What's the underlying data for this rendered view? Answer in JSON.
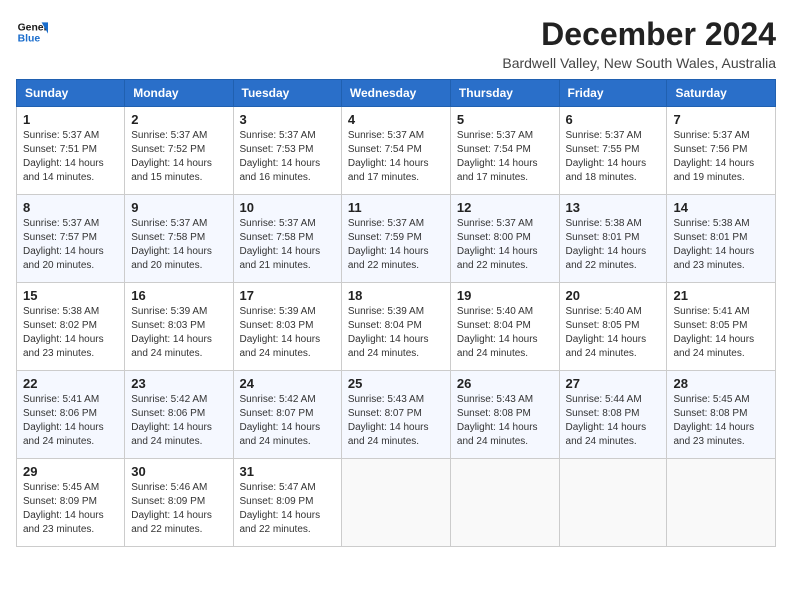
{
  "logo": {
    "text_general": "General",
    "text_blue": "Blue"
  },
  "title": "December 2024",
  "location": "Bardwell Valley, New South Wales, Australia",
  "days_of_week": [
    "Sunday",
    "Monday",
    "Tuesday",
    "Wednesday",
    "Thursday",
    "Friday",
    "Saturday"
  ],
  "weeks": [
    [
      {
        "day": 1,
        "sunrise": "5:37 AM",
        "sunset": "7:51 PM",
        "daylight": "14 hours and 14 minutes."
      },
      {
        "day": 2,
        "sunrise": "5:37 AM",
        "sunset": "7:52 PM",
        "daylight": "14 hours and 15 minutes."
      },
      {
        "day": 3,
        "sunrise": "5:37 AM",
        "sunset": "7:53 PM",
        "daylight": "14 hours and 16 minutes."
      },
      {
        "day": 4,
        "sunrise": "5:37 AM",
        "sunset": "7:54 PM",
        "daylight": "14 hours and 17 minutes."
      },
      {
        "day": 5,
        "sunrise": "5:37 AM",
        "sunset": "7:54 PM",
        "daylight": "14 hours and 17 minutes."
      },
      {
        "day": 6,
        "sunrise": "5:37 AM",
        "sunset": "7:55 PM",
        "daylight": "14 hours and 18 minutes."
      },
      {
        "day": 7,
        "sunrise": "5:37 AM",
        "sunset": "7:56 PM",
        "daylight": "14 hours and 19 minutes."
      }
    ],
    [
      {
        "day": 8,
        "sunrise": "5:37 AM",
        "sunset": "7:57 PM",
        "daylight": "14 hours and 20 minutes."
      },
      {
        "day": 9,
        "sunrise": "5:37 AM",
        "sunset": "7:58 PM",
        "daylight": "14 hours and 20 minutes."
      },
      {
        "day": 10,
        "sunrise": "5:37 AM",
        "sunset": "7:58 PM",
        "daylight": "14 hours and 21 minutes."
      },
      {
        "day": 11,
        "sunrise": "5:37 AM",
        "sunset": "7:59 PM",
        "daylight": "14 hours and 22 minutes."
      },
      {
        "day": 12,
        "sunrise": "5:37 AM",
        "sunset": "8:00 PM",
        "daylight": "14 hours and 22 minutes."
      },
      {
        "day": 13,
        "sunrise": "5:38 AM",
        "sunset": "8:01 PM",
        "daylight": "14 hours and 22 minutes."
      },
      {
        "day": 14,
        "sunrise": "5:38 AM",
        "sunset": "8:01 PM",
        "daylight": "14 hours and 23 minutes."
      }
    ],
    [
      {
        "day": 15,
        "sunrise": "5:38 AM",
        "sunset": "8:02 PM",
        "daylight": "14 hours and 23 minutes."
      },
      {
        "day": 16,
        "sunrise": "5:39 AM",
        "sunset": "8:03 PM",
        "daylight": "14 hours and 24 minutes."
      },
      {
        "day": 17,
        "sunrise": "5:39 AM",
        "sunset": "8:03 PM",
        "daylight": "14 hours and 24 minutes."
      },
      {
        "day": 18,
        "sunrise": "5:39 AM",
        "sunset": "8:04 PM",
        "daylight": "14 hours and 24 minutes."
      },
      {
        "day": 19,
        "sunrise": "5:40 AM",
        "sunset": "8:04 PM",
        "daylight": "14 hours and 24 minutes."
      },
      {
        "day": 20,
        "sunrise": "5:40 AM",
        "sunset": "8:05 PM",
        "daylight": "14 hours and 24 minutes."
      },
      {
        "day": 21,
        "sunrise": "5:41 AM",
        "sunset": "8:05 PM",
        "daylight": "14 hours and 24 minutes."
      }
    ],
    [
      {
        "day": 22,
        "sunrise": "5:41 AM",
        "sunset": "8:06 PM",
        "daylight": "14 hours and 24 minutes."
      },
      {
        "day": 23,
        "sunrise": "5:42 AM",
        "sunset": "8:06 PM",
        "daylight": "14 hours and 24 minutes."
      },
      {
        "day": 24,
        "sunrise": "5:42 AM",
        "sunset": "8:07 PM",
        "daylight": "14 hours and 24 minutes."
      },
      {
        "day": 25,
        "sunrise": "5:43 AM",
        "sunset": "8:07 PM",
        "daylight": "14 hours and 24 minutes."
      },
      {
        "day": 26,
        "sunrise": "5:43 AM",
        "sunset": "8:08 PM",
        "daylight": "14 hours and 24 minutes."
      },
      {
        "day": 27,
        "sunrise": "5:44 AM",
        "sunset": "8:08 PM",
        "daylight": "14 hours and 24 minutes."
      },
      {
        "day": 28,
        "sunrise": "5:45 AM",
        "sunset": "8:08 PM",
        "daylight": "14 hours and 23 minutes."
      }
    ],
    [
      {
        "day": 29,
        "sunrise": "5:45 AM",
        "sunset": "8:09 PM",
        "daylight": "14 hours and 23 minutes."
      },
      {
        "day": 30,
        "sunrise": "5:46 AM",
        "sunset": "8:09 PM",
        "daylight": "14 hours and 22 minutes."
      },
      {
        "day": 31,
        "sunrise": "5:47 AM",
        "sunset": "8:09 PM",
        "daylight": "14 hours and 22 minutes."
      },
      null,
      null,
      null,
      null
    ]
  ],
  "labels": {
    "sunrise": "Sunrise:",
    "sunset": "Sunset:",
    "daylight": "Daylight:"
  }
}
